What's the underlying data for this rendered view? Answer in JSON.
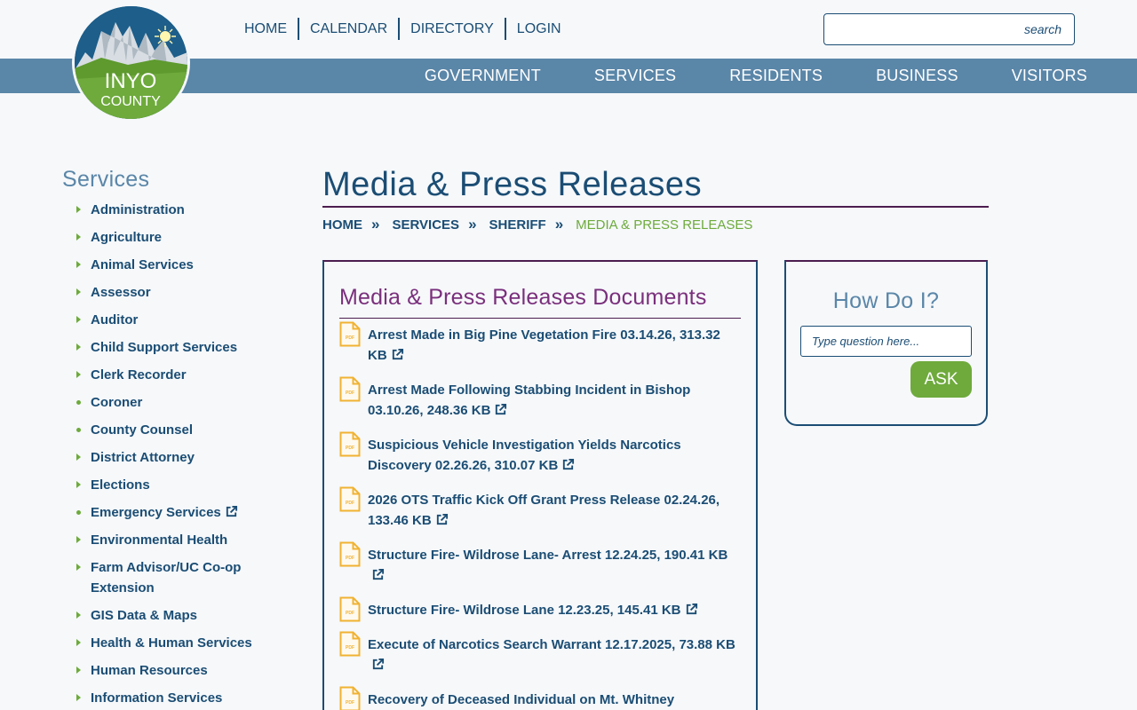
{
  "logo": {
    "line1": "INYO",
    "line2": "COUNTY"
  },
  "utility_nav": [
    "HOME",
    "CALENDAR",
    "DIRECTORY",
    "LOGIN"
  ],
  "search": {
    "placeholder": "search"
  },
  "main_nav": [
    "GOVERNMENT",
    "SERVICES",
    "RESIDENTS",
    "BUSINESS",
    "VISITORS"
  ],
  "sidebar": {
    "title": "Services",
    "items": [
      {
        "label": "Administration",
        "marker": "triangle",
        "external": false
      },
      {
        "label": "Agriculture",
        "marker": "triangle",
        "external": false
      },
      {
        "label": "Animal Services",
        "marker": "triangle",
        "external": false
      },
      {
        "label": "Assessor",
        "marker": "triangle",
        "external": false
      },
      {
        "label": "Auditor",
        "marker": "triangle",
        "external": false
      },
      {
        "label": "Child Support Services",
        "marker": "triangle",
        "external": false
      },
      {
        "label": "Clerk Recorder",
        "marker": "triangle",
        "external": false
      },
      {
        "label": "Coroner",
        "marker": "dot",
        "external": false
      },
      {
        "label": "County Counsel",
        "marker": "dot",
        "external": false
      },
      {
        "label": "District Attorney",
        "marker": "triangle",
        "external": false
      },
      {
        "label": "Elections",
        "marker": "triangle",
        "external": false
      },
      {
        "label": "Emergency Services",
        "marker": "dot",
        "external": true
      },
      {
        "label": "Environmental Health",
        "marker": "triangle",
        "external": false
      },
      {
        "label": "Farm Advisor/UC Co-op Extension",
        "marker": "triangle",
        "external": false
      },
      {
        "label": "GIS Data & Maps",
        "marker": "triangle",
        "external": false
      },
      {
        "label": "Health & Human Services",
        "marker": "triangle",
        "external": false
      },
      {
        "label": "Human Resources",
        "marker": "triangle",
        "external": false
      },
      {
        "label": "Information Services",
        "marker": "triangle",
        "external": false
      }
    ]
  },
  "page": {
    "title": "Media & Press Releases",
    "breadcrumb": [
      "HOME",
      "SERVICES",
      "SHERIFF"
    ],
    "breadcrumb_current": "MEDIA & PRESS RELEASES"
  },
  "documents": {
    "title": "Media & Press Releases Documents",
    "items": [
      "Arrest Made in Big Pine Vegetation Fire 03.14.26, 313.32 KB",
      "Arrest Made Following Stabbing Incident in Bishop 03.10.26, 248.36 KB",
      "Suspicious Vehicle Investigation Yields Narcotics Discovery 02.26.26, 310.07 KB",
      "2026 OTS Traffic Kick Off Grant Press Release 02.24.26, 133.46 KB",
      "Structure Fire- Wildrose Lane- Arrest 12.24.25, 190.41 KB",
      "Structure Fire- Wildrose Lane 12.23.25, 145.41 KB",
      "Execute of Narcotics Search Warrant 12.17.2025, 73.88 KB",
      "Recovery of Deceased Individual on Mt. Whitney"
    ]
  },
  "howdoi": {
    "title": "How Do I?",
    "placeholder": "Type question here...",
    "button": "ASK"
  },
  "colors": {
    "navy": "#1b4d74",
    "nav_band": "#5a86a8",
    "green": "#6eaa3c",
    "purple": "#7a2f7c",
    "pdf_orange": "#f0b232"
  },
  "icons": {
    "external": "external-link-icon",
    "pdf": "pdf-file-icon",
    "breadcrumb_sep": "double-chevron-icon"
  }
}
